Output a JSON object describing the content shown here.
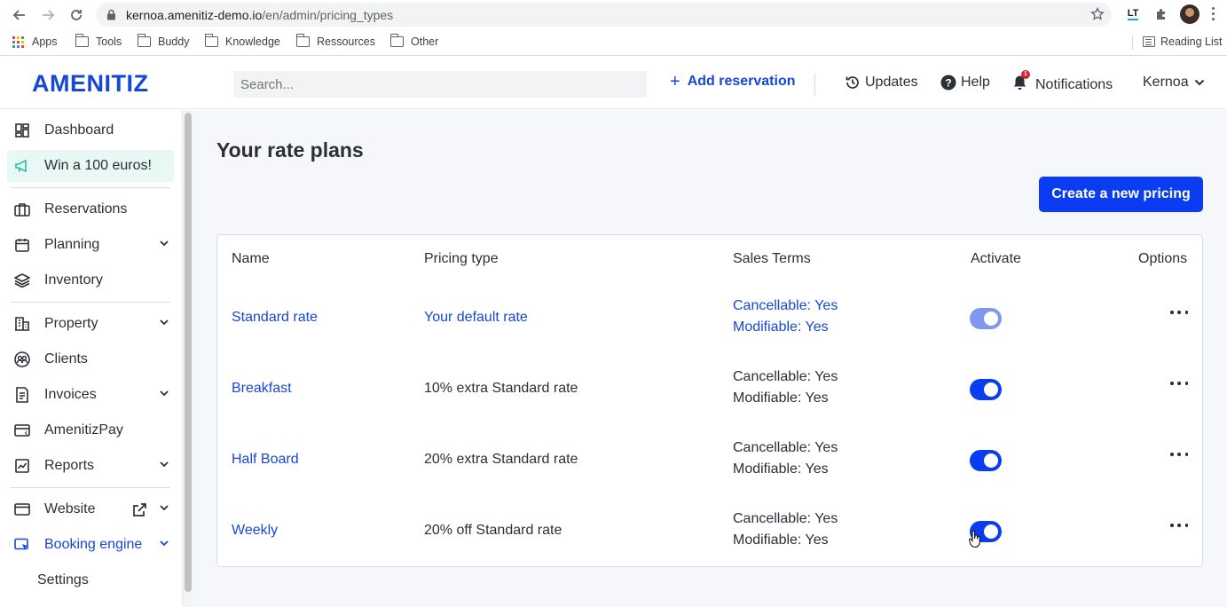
{
  "browser": {
    "url_domain": "kernoa.amenitiz-demo.io",
    "url_path": "/en/admin/pricing_types",
    "bookmarks": [
      "Apps",
      "Tools",
      "Buddy",
      "Knowledge",
      "Ressources",
      "Other"
    ],
    "reading_list": "Reading List"
  },
  "header": {
    "logo": "AMENITIZ",
    "search_placeholder": "Search...",
    "add_reservation": "Add reservation",
    "updates": "Updates",
    "help": "Help",
    "notifications": "Notifications",
    "notification_count": "1",
    "user": "Kernoa"
  },
  "sidebar": {
    "items": [
      {
        "label": "Dashboard",
        "icon": "dashboard-icon"
      },
      {
        "label": "Win a 100 euros!",
        "icon": "megaphone-icon"
      },
      {
        "label": "Reservations",
        "icon": "briefcase-icon"
      },
      {
        "label": "Planning",
        "icon": "calendar-icon"
      },
      {
        "label": "Inventory",
        "icon": "layers-icon"
      },
      {
        "label": "Property",
        "icon": "building-icon"
      },
      {
        "label": "Clients",
        "icon": "users-icon"
      },
      {
        "label": "Invoices",
        "icon": "invoice-icon"
      },
      {
        "label": "AmenitizPay",
        "icon": "card-icon"
      },
      {
        "label": "Reports",
        "icon": "chart-icon"
      },
      {
        "label": "Website",
        "icon": "browser-icon"
      },
      {
        "label": "Booking engine",
        "icon": "cursor-icon"
      },
      {
        "label": "Settings",
        "icon": ""
      }
    ]
  },
  "main": {
    "title": "Your rate plans",
    "create_button": "Create a new pricing",
    "columns": [
      "Name",
      "Pricing type",
      "Sales Terms",
      "Activate",
      "Options"
    ],
    "rows": [
      {
        "name": "Standard rate",
        "pricing_type": "Your default rate",
        "cancellable": "Cancellable: Yes",
        "modifiable": "Modifiable: Yes",
        "active": true,
        "locked": true
      },
      {
        "name": "Breakfast",
        "pricing_type": "10% extra Standard rate",
        "cancellable": "Cancellable: Yes",
        "modifiable": "Modifiable: Yes",
        "active": true,
        "locked": false
      },
      {
        "name": "Half Board",
        "pricing_type": "20% extra Standard rate",
        "cancellable": "Cancellable: Yes",
        "modifiable": "Modifiable: Yes",
        "active": true,
        "locked": false
      },
      {
        "name": "Weekly",
        "pricing_type": "20% off Standard rate",
        "cancellable": "Cancellable: Yes",
        "modifiable": "Modifiable: Yes",
        "active": true,
        "locked": false
      }
    ]
  },
  "colors": {
    "brand": "#1747d6",
    "primary_button": "#0a3df2",
    "promo_bg": "#e7f8f5"
  }
}
